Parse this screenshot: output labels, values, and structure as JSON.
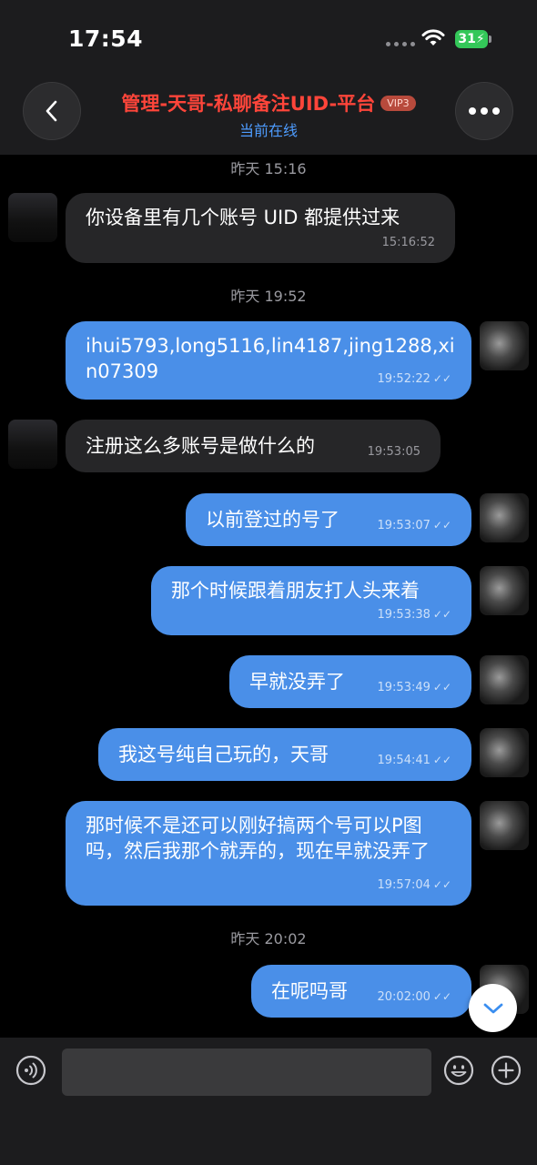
{
  "status_bar": {
    "time": "17:54",
    "battery": "31"
  },
  "header": {
    "title": "管理-天哥-私聊备注UID-平台",
    "badge": "VIP3",
    "subtitle": "当前在线"
  },
  "chat": {
    "dates": [
      "昨天 15:16",
      "昨天 19:52",
      "昨天 20:02"
    ],
    "messages": [
      {
        "side": "in",
        "text": "你设备里有几个账号 UID 都提供过来",
        "time": "15:16:52"
      },
      {
        "side": "out",
        "text": "ihui5793,long5116,lin4187,jing1288,xin07309",
        "time": "19:52:22",
        "read": true
      },
      {
        "side": "in",
        "text": "注册这么多账号是做什么的",
        "time": "19:53:05"
      },
      {
        "side": "out",
        "text": "以前登过的号了",
        "time": "19:53:07",
        "read": true
      },
      {
        "side": "out",
        "text": "那个时候跟着朋友打人头来着",
        "time": "19:53:38",
        "read": true
      },
      {
        "side": "out",
        "text": "早就没弄了",
        "time": "19:53:49",
        "read": true
      },
      {
        "side": "out",
        "text": "我这号纯自己玩的，天哥",
        "time": "19:54:41",
        "read": true
      },
      {
        "side": "out",
        "text": "那时候不是还可以刚好搞两个号可以P图吗，然后我那个就弄的，现在早就没弄了",
        "time": "19:57:04",
        "read": true
      },
      {
        "side": "out",
        "text": "在呢吗哥",
        "time": "20:02:00",
        "read": true
      }
    ]
  },
  "input_bar": {
    "placeholder": ""
  },
  "icons": {
    "back": "chevron-left-icon",
    "more": "more-dots-icon",
    "scroll_down": "chevron-down-icon",
    "mic": "voice-icon",
    "emoji": "emoji-icon",
    "plus": "plus-icon"
  },
  "colors": {
    "title": "#ff453a",
    "online": "#4e9cff",
    "outgoing_bubble": "#4a8fe8",
    "incoming_bubble": "#262628"
  }
}
